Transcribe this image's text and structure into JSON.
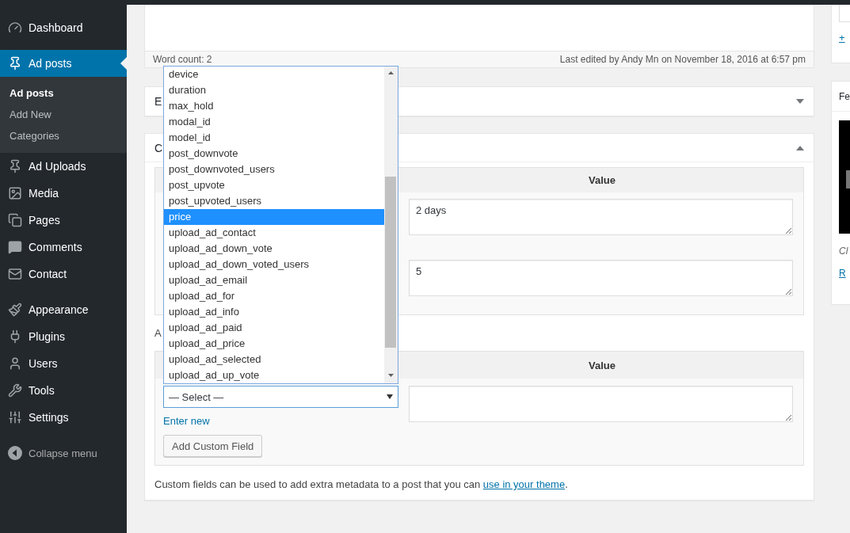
{
  "sidebar": {
    "groups": [
      [
        {
          "label": "Dashboard",
          "selected": false
        }
      ],
      [
        {
          "label": "Ad posts",
          "selected": true,
          "children": [
            {
              "label": "Ad posts",
              "selected": true
            },
            {
              "label": "Add New",
              "selected": false
            },
            {
              "label": "Categories",
              "selected": false
            }
          ]
        },
        {
          "label": "Ad Uploads",
          "selected": false
        },
        {
          "label": "Media",
          "selected": false
        },
        {
          "label": "Pages",
          "selected": false
        },
        {
          "label": "Comments",
          "selected": false
        },
        {
          "label": "Contact",
          "selected": false
        }
      ],
      [
        {
          "label": "Appearance",
          "selected": false
        },
        {
          "label": "Plugins",
          "selected": false
        },
        {
          "label": "Users",
          "selected": false
        },
        {
          "label": "Tools",
          "selected": false
        },
        {
          "label": "Settings",
          "selected": false
        }
      ]
    ],
    "collapse": "Collapse menu"
  },
  "editor": {
    "word_count": "Word count: 2",
    "last_edited": "Last edited by Andy Mn on November 18, 2016 at 6:57 pm"
  },
  "excerpt_box": {
    "title": "E",
    "expanded": false
  },
  "custom_fields_box": {
    "title": "C",
    "expanded": true,
    "table": {
      "column_2": "Value",
      "rows": [
        {
          "value": "2 days"
        },
        {
          "value": "5"
        }
      ]
    },
    "add_heading": "A",
    "add_table": {
      "column_2": "Value",
      "select": {
        "value": "— Select —",
        "expanded": true,
        "options": [
          {
            "label": "device",
            "selected": false
          },
          {
            "label": "duration",
            "selected": false
          },
          {
            "label": "max_hold",
            "selected": false
          },
          {
            "label": "modal_id",
            "selected": false
          },
          {
            "label": "model_id",
            "selected": false
          },
          {
            "label": "post_downvote",
            "selected": false
          },
          {
            "label": "post_downvoted_users",
            "selected": false
          },
          {
            "label": "post_upvote",
            "selected": false
          },
          {
            "label": "post_upvoted_users",
            "selected": false
          },
          {
            "label": "price",
            "selected": true
          },
          {
            "label": "upload_ad_contact",
            "selected": false
          },
          {
            "label": "upload_ad_down_vote",
            "selected": false
          },
          {
            "label": "upload_ad_down_voted_users",
            "selected": false
          },
          {
            "label": "upload_ad_email",
            "selected": false
          },
          {
            "label": "upload_ad_for",
            "selected": false
          },
          {
            "label": "upload_ad_info",
            "selected": false
          },
          {
            "label": "upload_ad_paid",
            "selected": false
          },
          {
            "label": "upload_ad_price",
            "selected": false
          },
          {
            "label": "upload_ad_selected",
            "selected": false
          },
          {
            "label": "upload_ad_up_vote",
            "selected": false
          }
        ]
      },
      "enter_new": "Enter new",
      "button": "Add Custom Field"
    },
    "note": {
      "before": "Custom fields can be used to add extra metadata to a post that you can ",
      "link": "use in your theme",
      "after": "."
    }
  },
  "side_boxes": {
    "first": {
      "link": "+"
    },
    "featured": {
      "title": "Fe",
      "caption": "Cl",
      "link": "R"
    }
  }
}
